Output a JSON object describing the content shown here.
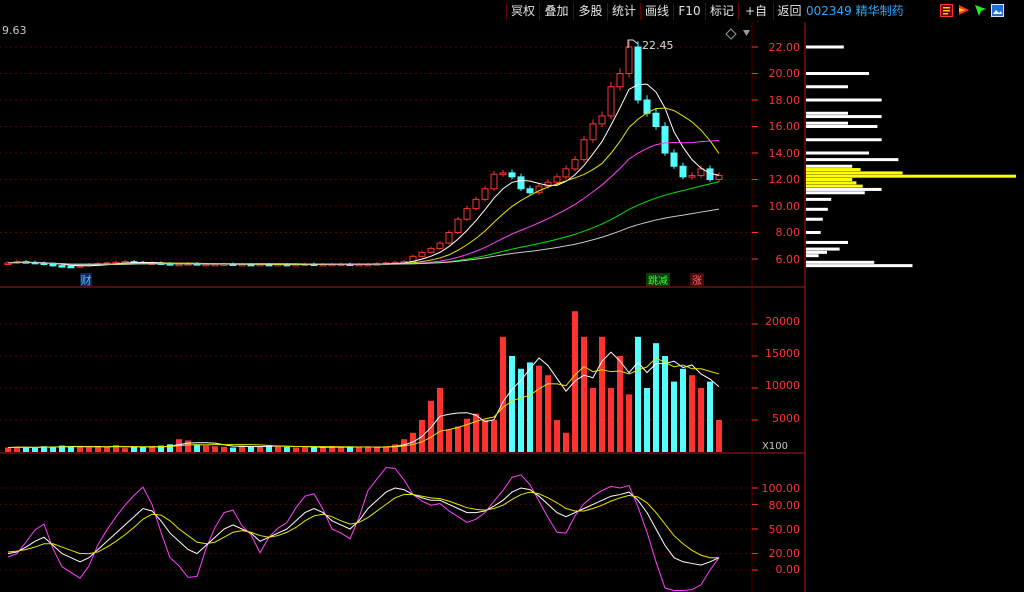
{
  "toolbar": {
    "buttons": [
      "冥权",
      "叠加",
      "多股",
      "统计",
      "画线",
      "F10",
      "标记",
      "+自选",
      "返回"
    ],
    "stock_code": "002349",
    "stock_name": "精华制药"
  },
  "price_panel": {
    "current_value_label": "9.63",
    "peak_label": "22.45",
    "axis_ticks": [
      "22.00",
      "20.00",
      "18.00",
      "16.00",
      "14.00",
      "12.00",
      "10.00",
      "8.00",
      "6.00"
    ],
    "tag_cai": "财",
    "tag_tiaokong": "跳减",
    "tag_zhang": "涨"
  },
  "volume_panel": {
    "axis_ticks": [
      "20000",
      "15000",
      "10000",
      "5000"
    ],
    "unit_label": "X100"
  },
  "indicator_panel": {
    "axis_ticks": [
      "100.00",
      "80.00",
      "50.00",
      "20.00",
      "0.00"
    ]
  },
  "colors": {
    "up": "#ff3232",
    "down": "#54ffff",
    "ma1": "#ffffff",
    "ma2": "#e6e600",
    "ma3": "#ff40ff",
    "ma4": "#00e600",
    "grid": "#5a0000",
    "profile_white": "#ffffff",
    "profile_yellow": "#ffff00"
  },
  "chart_data": {
    "type": "candlestick",
    "x_count": 80,
    "price_range": [
      5,
      23
    ],
    "closes": [
      5.7,
      5.8,
      5.75,
      5.7,
      5.6,
      5.5,
      5.45,
      5.4,
      5.5,
      5.6,
      5.65,
      5.7,
      5.75,
      5.8,
      5.75,
      5.7,
      5.7,
      5.65,
      5.6,
      5.6,
      5.65,
      5.6,
      5.6,
      5.6,
      5.62,
      5.6,
      5.6,
      5.58,
      5.6,
      5.58,
      5.6,
      5.58,
      5.6,
      5.62,
      5.6,
      5.6,
      5.6,
      5.62,
      5.6,
      5.6,
      5.6,
      5.65,
      5.7,
      5.75,
      5.8,
      6.2,
      6.5,
      6.8,
      7.2,
      8.0,
      9.0,
      9.8,
      10.5,
      11.3,
      12.4,
      12.5,
      12.2,
      11.3,
      11.0,
      11.5,
      11.8,
      12.2,
      12.8,
      13.5,
      15.0,
      16.2,
      16.8,
      19.0,
      20.0,
      22.0,
      18.0,
      17.0,
      16.0,
      14.0,
      13.0,
      12.2,
      12.3,
      12.8,
      12.0,
      12.3
    ],
    "volumes": [
      700,
      800,
      750,
      650,
      900,
      800,
      1000,
      900,
      800,
      700,
      900,
      750,
      1100,
      600,
      800,
      700,
      900,
      1000,
      1200,
      2000,
      1800,
      1200,
      1000,
      900,
      800,
      700,
      1000,
      900,
      800,
      1100,
      900,
      800,
      700,
      800,
      750,
      700,
      900,
      800,
      700,
      800,
      800,
      700,
      900,
      1200,
      2000,
      3000,
      5000,
      8000,
      10000,
      3500,
      4000,
      5200,
      6000,
      5000,
      5000,
      18000,
      15000,
      13000,
      14000,
      13500,
      12000,
      5000,
      3000,
      22000,
      18000,
      10000,
      18000,
      10000,
      15000,
      9000,
      18000,
      10000,
      17000,
      15000,
      11000,
      13000,
      12000,
      10000,
      11000,
      5000
    ],
    "kd_k": [
      20,
      22,
      28,
      35,
      40,
      30,
      20,
      15,
      10,
      15,
      25,
      35,
      45,
      55,
      65,
      75,
      72,
      60,
      45,
      35,
      25,
      20,
      30,
      40,
      50,
      55,
      50,
      45,
      35,
      40,
      45,
      50,
      60,
      70,
      75,
      70,
      60,
      55,
      50,
      60,
      75,
      85,
      95,
      100,
      98,
      92,
      88,
      85,
      85,
      80,
      75,
      70,
      70,
      72,
      78,
      85,
      95,
      100,
      98,
      90,
      80,
      70,
      65,
      70,
      75,
      80,
      85,
      90,
      92,
      95,
      85,
      70,
      50,
      30,
      15,
      10,
      8,
      6,
      10,
      15
    ],
    "kd_d": [
      22,
      23,
      25,
      28,
      32,
      32,
      28,
      24,
      20,
      20,
      22,
      28,
      35,
      43,
      52,
      62,
      68,
      67,
      60,
      50,
      42,
      34,
      32,
      34,
      40,
      46,
      48,
      46,
      42,
      40,
      42,
      46,
      52,
      60,
      66,
      68,
      65,
      60,
      56,
      58,
      64,
      72,
      80,
      88,
      92,
      92,
      90,
      88,
      87,
      84,
      80,
      76,
      74,
      73,
      75,
      79,
      86,
      92,
      95,
      93,
      88,
      82,
      75,
      72,
      72,
      75,
      79,
      84,
      88,
      91,
      89,
      82,
      70,
      56,
      42,
      32,
      24,
      18,
      15,
      15
    ]
  }
}
